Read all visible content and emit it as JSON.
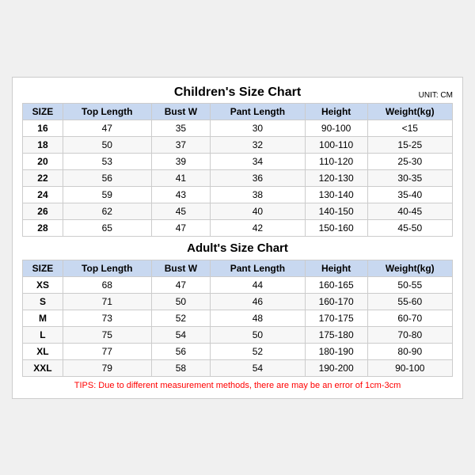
{
  "title": "Children's Size Chart",
  "unitLabel": "UNIT: CM",
  "columns": [
    "SIZE",
    "Top Length",
    "Bust W",
    "Pant Length",
    "Height",
    "Weight(kg)"
  ],
  "childrenRows": [
    [
      "16",
      "47",
      "35",
      "30",
      "90-100",
      "<15"
    ],
    [
      "18",
      "50",
      "37",
      "32",
      "100-110",
      "15-25"
    ],
    [
      "20",
      "53",
      "39",
      "34",
      "110-120",
      "25-30"
    ],
    [
      "22",
      "56",
      "41",
      "36",
      "120-130",
      "30-35"
    ],
    [
      "24",
      "59",
      "43",
      "38",
      "130-140",
      "35-40"
    ],
    [
      "26",
      "62",
      "45",
      "40",
      "140-150",
      "40-45"
    ],
    [
      "28",
      "65",
      "47",
      "42",
      "150-160",
      "45-50"
    ]
  ],
  "adultTitle": "Adult's Size Chart",
  "adultRows": [
    [
      "XS",
      "68",
      "47",
      "44",
      "160-165",
      "50-55"
    ],
    [
      "S",
      "71",
      "50",
      "46",
      "160-170",
      "55-60"
    ],
    [
      "M",
      "73",
      "52",
      "48",
      "170-175",
      "60-70"
    ],
    [
      "L",
      "75",
      "54",
      "50",
      "175-180",
      "70-80"
    ],
    [
      "XL",
      "77",
      "56",
      "52",
      "180-190",
      "80-90"
    ],
    [
      "XXL",
      "79",
      "58",
      "54",
      "190-200",
      "90-100"
    ]
  ],
  "tips": "TIPS: Due to different measurement methods, there are may be an error of 1cm-3cm"
}
